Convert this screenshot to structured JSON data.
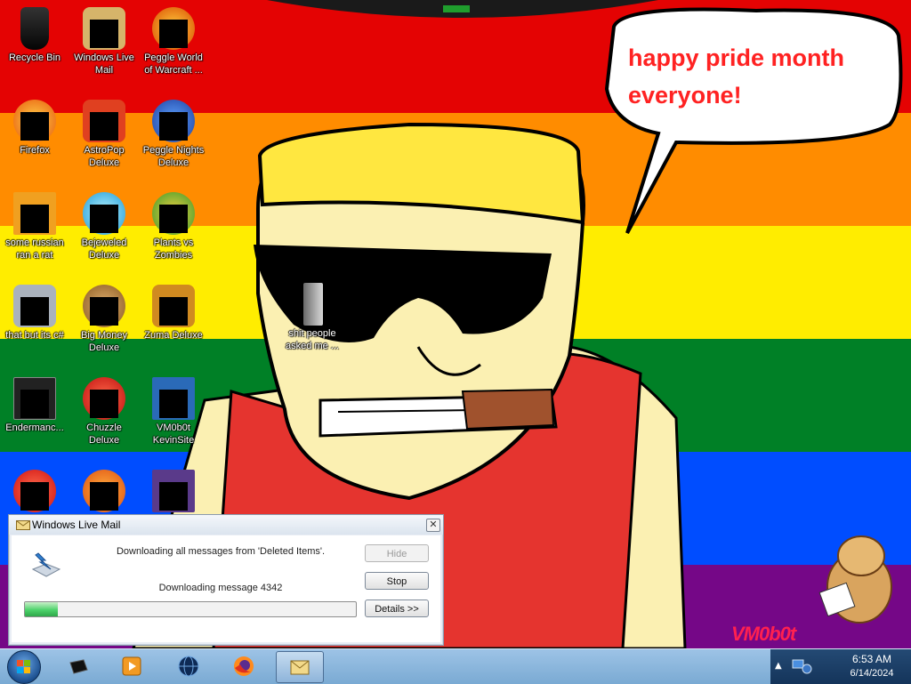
{
  "wallpaper": {
    "stripes": [
      "#e40303",
      "#ff8c00",
      "#ffed00",
      "#008026",
      "#004dff",
      "#750787"
    ],
    "bubble_text": "happy pride month everyone!",
    "signature": "VM0b0t"
  },
  "desktop_icons": [
    {
      "label": "Recycle Bin",
      "icon": "recycle-bin-icon"
    },
    {
      "label": "Windows Live\nMail",
      "icon": "windows-live-mail-icon"
    },
    {
      "label": "Peggle World\nof Warcraft ...",
      "icon": "peggle-wow-icon"
    },
    {
      "label": "Firefox",
      "icon": "firefox-icon"
    },
    {
      "label": "AstroPop\nDeluxe",
      "icon": "astropop-icon"
    },
    {
      "label": "Peggle Nights\nDeluxe",
      "icon": "peggle-nights-icon"
    },
    {
      "label": "some russian\nran a rat",
      "icon": "rat-icon"
    },
    {
      "label": "Bejeweled\nDeluxe",
      "icon": "bejeweled-icon"
    },
    {
      "label": "Plants vs\nZombies",
      "icon": "plants-vs-zombies-icon"
    },
    {
      "label": "that but its c#",
      "icon": "folder-icon"
    },
    {
      "label": "Big Money\nDeluxe",
      "icon": "big-money-icon"
    },
    {
      "label": "Zuma Deluxe",
      "icon": "zuma-icon"
    },
    {
      "label": "Endermanc...",
      "icon": "terminal-icon"
    },
    {
      "label": "Chuzzle\nDeluxe",
      "icon": "chuzzle-icon"
    },
    {
      "label": "VM0b0t\nKevinSite",
      "icon": "website-icon"
    },
    {
      "label": "shit people\nasked me ...",
      "icon": "file-icon"
    }
  ],
  "dialog": {
    "title": "Windows Live Mail",
    "close_label": "✕",
    "message_top": "Downloading all messages from 'Deleted Items'.",
    "message_bottom": "Downloading message 4342",
    "progress": 0.1,
    "buttons": {
      "hide": "Hide",
      "stop": "Stop",
      "details": "Details >>"
    }
  },
  "taskbar": {
    "items": [
      {
        "icon": "media-center-icon"
      },
      {
        "icon": "media-player-icon"
      },
      {
        "icon": "globe-icon"
      },
      {
        "icon": "firefox-icon"
      },
      {
        "icon": "windows-live-mail-icon",
        "active": true
      }
    ],
    "tray": {
      "show_hidden": "▲",
      "time": "6:53 AM",
      "date": "6/14/2024"
    }
  }
}
